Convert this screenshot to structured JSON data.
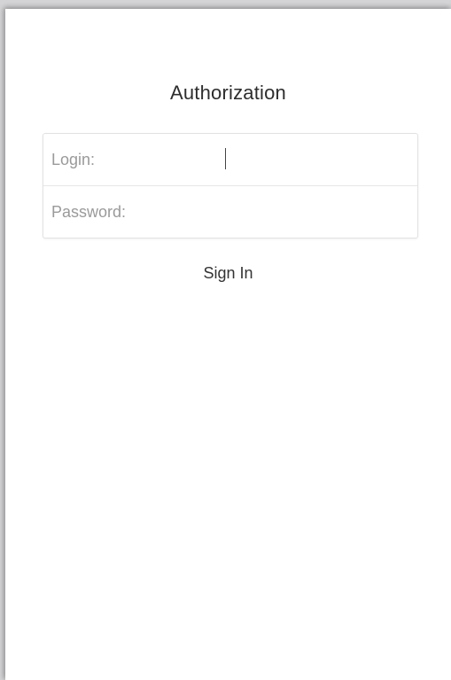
{
  "auth": {
    "title": "Authorization",
    "login": {
      "label": "Login:",
      "value": ""
    },
    "password": {
      "label": "Password:",
      "value": ""
    },
    "sign_in_label": "Sign In"
  }
}
